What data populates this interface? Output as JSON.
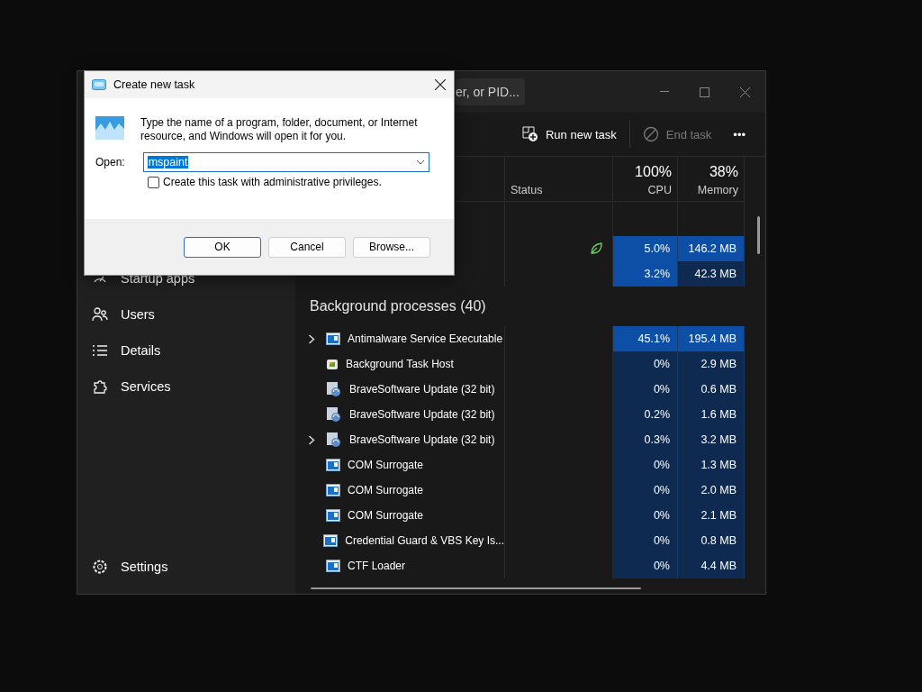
{
  "task_manager": {
    "search": {
      "placeholder": "er, or PID..."
    },
    "toolbar": [
      {
        "label": "Run new task",
        "kind": "run",
        "disabled": false
      },
      {
        "label": "End task",
        "kind": "end",
        "disabled": true
      },
      {
        "label": "•••",
        "kind": "more",
        "disabled": false
      }
    ],
    "sidebar": {
      "items": [
        {
          "label": "Startup apps",
          "kind": "startup"
        },
        {
          "label": "Users",
          "kind": "users"
        },
        {
          "label": "Details",
          "kind": "details"
        },
        {
          "label": "Services",
          "kind": "services"
        }
      ],
      "settings": {
        "label": "Settings"
      }
    },
    "columns": {
      "status": {
        "label": "Status"
      },
      "cpu": {
        "total": "100%",
        "label": "CPU"
      },
      "memory": {
        "total": "38%",
        "label": "Memory"
      }
    },
    "apps": [
      {
        "efficiency_mode": true,
        "cpu": "5.0%",
        "memory": "146.2 MB",
        "cpu_hot": true,
        "memory_hot": true
      },
      {
        "efficiency_mode": false,
        "cpu": "3.2%",
        "memory": "42.3 MB",
        "cpu_hot": true,
        "memory_hot": false
      }
    ],
    "background": {
      "heading": "Background processes (40)",
      "rows": [
        {
          "name": "Antimalware Service Executable",
          "kind": "window",
          "expandable": true,
          "cpu": "45.1%",
          "memory": "195.4 MB",
          "cpu_hot": true,
          "memory_hot": true
        },
        {
          "name": "Background Task Host",
          "kind": "host",
          "expandable": false,
          "cpu": "0%",
          "memory": "2.9 MB",
          "cpu_hot": false,
          "memory_hot": false
        },
        {
          "name": "BraveSoftware Update (32 bit)",
          "kind": "updater",
          "expandable": false,
          "cpu": "0%",
          "memory": "0.6 MB",
          "cpu_hot": false,
          "memory_hot": false
        },
        {
          "name": "BraveSoftware Update (32 bit)",
          "kind": "updater",
          "expandable": false,
          "cpu": "0.2%",
          "memory": "1.6 MB",
          "cpu_hot": false,
          "memory_hot": false
        },
        {
          "name": "BraveSoftware Update (32 bit)",
          "kind": "updater",
          "expandable": true,
          "cpu": "0.3%",
          "memory": "3.2 MB",
          "cpu_hot": false,
          "memory_hot": false
        },
        {
          "name": "COM Surrogate",
          "kind": "window",
          "expandable": false,
          "cpu": "0%",
          "memory": "1.3 MB",
          "cpu_hot": false,
          "memory_hot": false
        },
        {
          "name": "COM Surrogate",
          "kind": "window",
          "expandable": false,
          "cpu": "0%",
          "memory": "2.0 MB",
          "cpu_hot": false,
          "memory_hot": false
        },
        {
          "name": "COM Surrogate",
          "kind": "window",
          "expandable": false,
          "cpu": "0%",
          "memory": "2.1 MB",
          "cpu_hot": false,
          "memory_hot": false
        },
        {
          "name": "Credential Guard & VBS Key Is...",
          "kind": "window",
          "expandable": false,
          "cpu": "0%",
          "memory": "0.8 MB",
          "cpu_hot": false,
          "memory_hot": false
        },
        {
          "name": "CTF Loader",
          "kind": "window",
          "expandable": false,
          "cpu": "0%",
          "memory": "4.4 MB",
          "cpu_hot": false,
          "memory_hot": false
        }
      ]
    }
  },
  "dialog": {
    "title": "Create new task",
    "message": "Type the name of a program, folder, document, or Internet resource, and Windows will open it for you.",
    "open_label": "Open:",
    "open_value": "mspaint",
    "admin": {
      "label": "Create this task with administrative privileges.",
      "checked": false
    },
    "buttons": [
      {
        "label": "OK",
        "focused": true
      },
      {
        "label": "Cancel",
        "focused": false
      },
      {
        "label": "Browse...",
        "focused": false
      }
    ]
  }
}
